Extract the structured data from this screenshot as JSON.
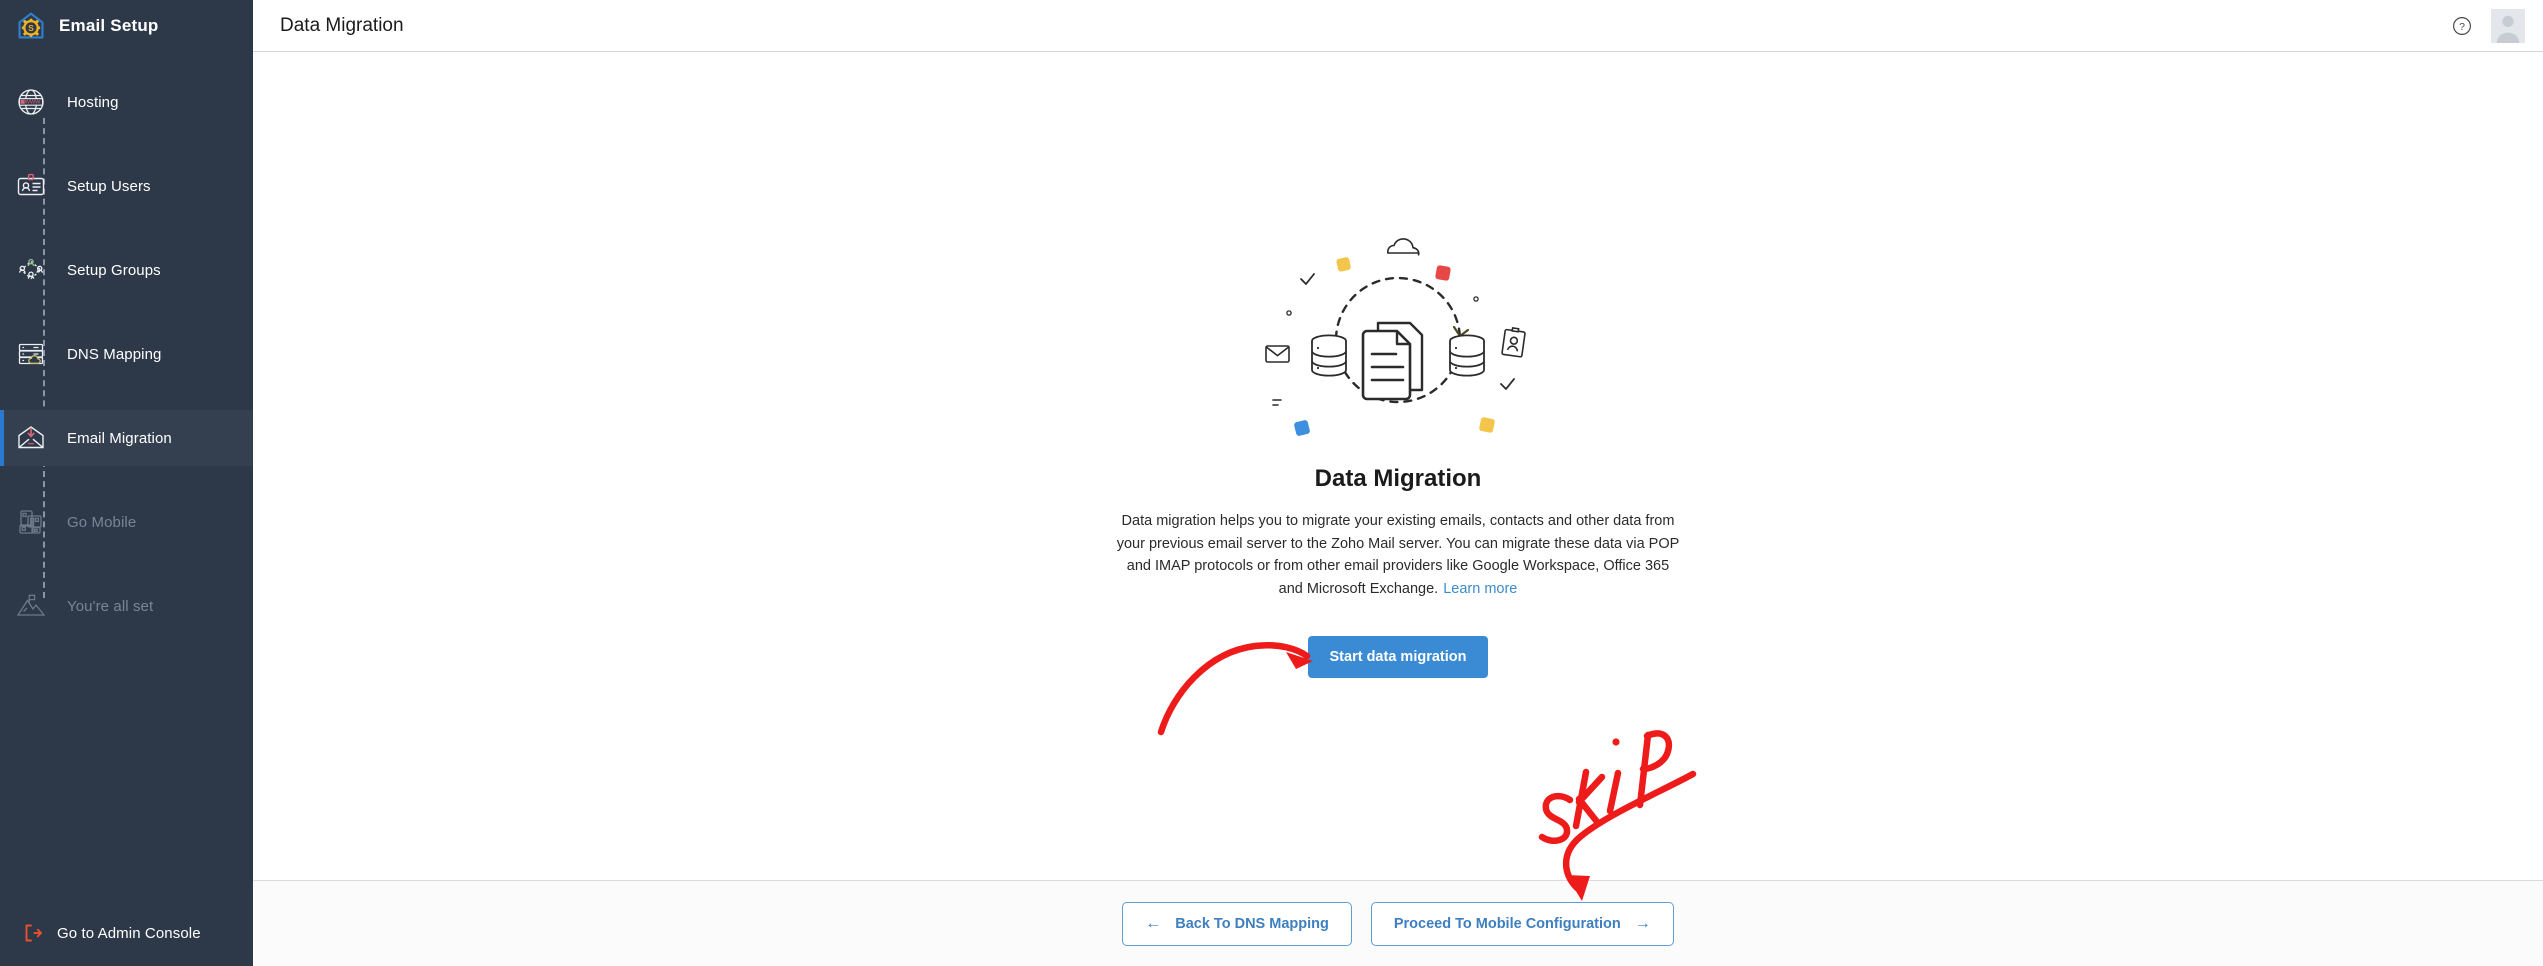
{
  "colors": {
    "sidebar_bg": "#2d3848",
    "sidebar_active_bg": "#343f50",
    "accent_blue": "#3a8bd4",
    "active_marker": "#2a7bd0",
    "link_blue": "#3d8bc9",
    "footer_btn_border": "#5f9dd3",
    "annotation_red": "#ee1b1b",
    "admin_console_red": "#e8502f",
    "main_bg": "#ffffff",
    "footer_bg": "#fbfbfc"
  },
  "sidebar": {
    "logo_icon": "house-gear-logo-icon",
    "title": "Email Setup",
    "items": [
      {
        "label": "Hosting",
        "icon": "globe-www-icon",
        "state": "done"
      },
      {
        "label": "Setup Users",
        "icon": "id-card-user-icon",
        "state": "done"
      },
      {
        "label": "Setup Groups",
        "icon": "user-group-icon",
        "state": "done"
      },
      {
        "label": "DNS Mapping",
        "icon": "server-cloud-icon",
        "state": "done"
      },
      {
        "label": "Email Migration",
        "icon": "envelope-download-icon",
        "state": "active"
      },
      {
        "label": "Go Mobile",
        "icon": "mobile-devices-icon",
        "state": "disabled"
      },
      {
        "label": "You're all set",
        "icon": "mountain-flag-icon",
        "state": "disabled"
      }
    ],
    "footer": {
      "label": "Go to Admin Console",
      "icon": "exit-arrow-icon"
    }
  },
  "topbar": {
    "title": "Data Migration",
    "help_icon": "question-circle-icon",
    "avatar_icon": "user-avatar"
  },
  "content": {
    "illustration_icon": "data-migration-illustration",
    "heading": "Data Migration",
    "description": "Data migration helps you to migrate your existing emails, contacts and other data from your previous email server to the Zoho Mail server. You can migrate these data via POP and IMAP protocols or from other email providers like Google Workspace, Office 365 and Microsoft Exchange.",
    "learn_more": "Learn more",
    "cta_label": "Start data migration"
  },
  "footer": {
    "back_label": "Back To DNS Mapping",
    "back_arrow": "←",
    "proceed_label": "Proceed To Mobile Configuration",
    "proceed_arrow": "→"
  },
  "annotations": {
    "skip_text": "SKIP",
    "arrow_to_cta": "curved-red-arrow-pointing-to-start-data-migration-button",
    "arrow_to_proceed": "curved-red-arrow-pointing-to-proceed-to-mobile-configuration-button"
  }
}
